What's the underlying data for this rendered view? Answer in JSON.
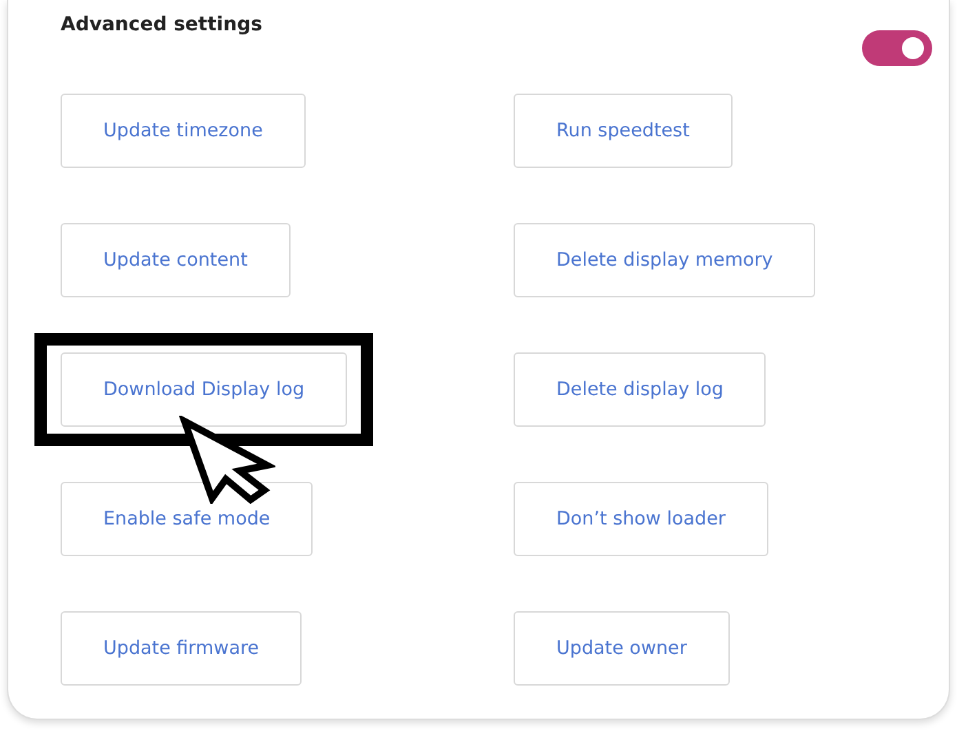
{
  "section": {
    "title": "Advanced settings",
    "toggle": {
      "on": true
    }
  },
  "buttons": [
    {
      "label": "Update timezone",
      "highlighted": false
    },
    {
      "label": "Run speedtest",
      "highlighted": false
    },
    {
      "label": "Update content",
      "highlighted": false
    },
    {
      "label": "Delete display memory",
      "highlighted": false
    },
    {
      "label": "Download Display log",
      "highlighted": true
    },
    {
      "label": "Delete display log",
      "highlighted": false
    },
    {
      "label": "Enable safe mode",
      "highlighted": false
    },
    {
      "label": "Don’t show loader",
      "highlighted": false
    },
    {
      "label": "Update firmware",
      "highlighted": false
    },
    {
      "label": "Update owner",
      "highlighted": false
    }
  ]
}
